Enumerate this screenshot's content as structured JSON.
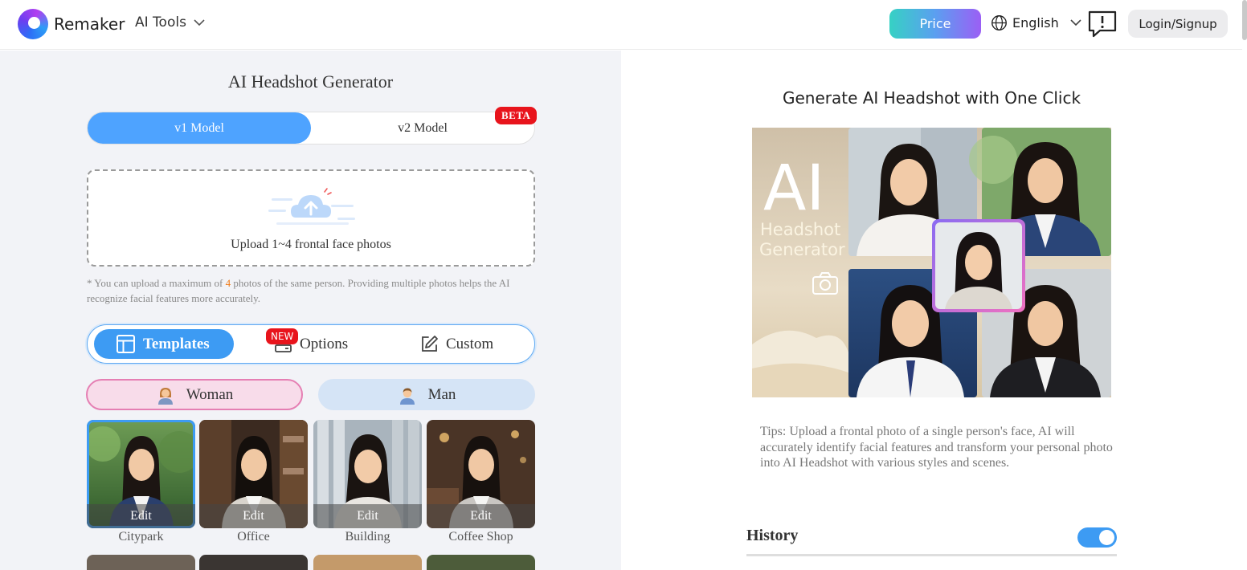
{
  "header": {
    "brand": "Remaker",
    "tools_label": "AI Tools",
    "price_label": "Price",
    "language": "English",
    "login_label": "Login/Signup",
    "colors": {
      "price_gradient": [
        "#36d1c4",
        "#9b5ff5"
      ],
      "accent": "#3d9bf3"
    }
  },
  "left": {
    "title": "AI Headshot Generator",
    "model_tabs": [
      {
        "label": "v1 Model",
        "active": true
      },
      {
        "label": "v2 Model",
        "active": false
      }
    ],
    "beta_badge": "BETA",
    "upload_text": "Upload 1~4 frontal face photos",
    "note_before": "* You can upload a maximum of ",
    "note_highlight": "4",
    "note_after": " photos of the same person. Providing multiple photos helps the AI recognize facial features more accurately.",
    "mode_tabs": [
      {
        "label": "Templates",
        "icon": "template-icon",
        "active": true
      },
      {
        "label": "Options",
        "icon": "options-icon",
        "active": false
      },
      {
        "label": "Custom",
        "icon": "edit-icon",
        "active": false
      }
    ],
    "new_badge": "NEW",
    "gender": [
      {
        "label": "Woman",
        "active": true
      },
      {
        "label": "Man",
        "active": false
      }
    ],
    "templates": [
      {
        "label": "Citypark",
        "edit": "Edit",
        "selected": true
      },
      {
        "label": "Office",
        "edit": "Edit",
        "selected": false
      },
      {
        "label": "Building",
        "edit": "Edit",
        "selected": false
      },
      {
        "label": "Coffee Shop",
        "edit": "Edit",
        "selected": false
      }
    ]
  },
  "right": {
    "title": "Generate AI Headshot with One Click",
    "hero": {
      "big": "AI",
      "line1": "Headshot",
      "line2": "Generator"
    },
    "tips": "Tips: Upload a frontal photo of a single person's face, AI will accurately identify facial features and transform your personal photo into AI Headshot with various styles and scenes.",
    "history_label": "History",
    "history_enabled": true
  }
}
